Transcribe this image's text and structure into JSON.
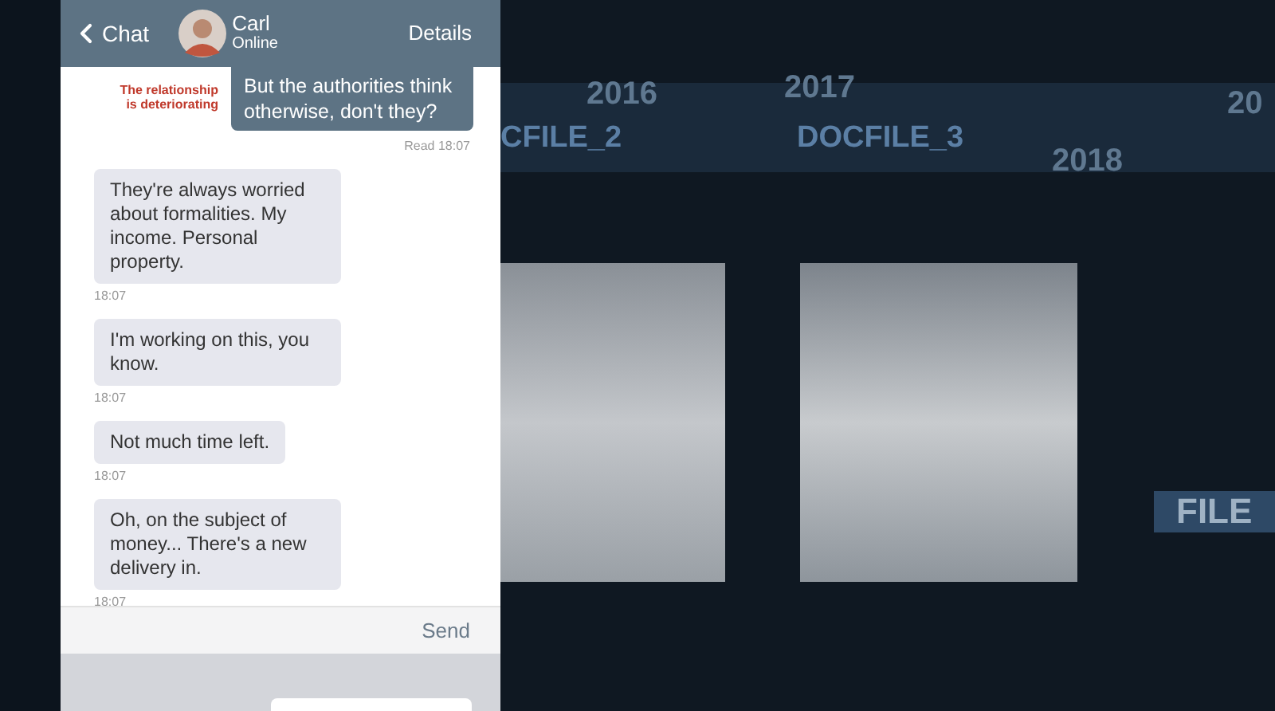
{
  "header": {
    "back": "Chat",
    "contact": {
      "name": "Carl",
      "status": "Online"
    },
    "details": "Details"
  },
  "messages": [
    {
      "kind": "outgoing",
      "text": "But the authorities think otherwise, don't they?",
      "note": "The relationship is deteriorating",
      "meta": "Read 18:07"
    },
    {
      "kind": "incoming",
      "text": "They're always worried about formalities. My income. Personal property.",
      "meta": "18:07"
    },
    {
      "kind": "incoming",
      "text": "I'm working on this, you know.",
      "meta": "18:07"
    },
    {
      "kind": "incoming",
      "text": "Not much time left.",
      "meta": "18:07"
    },
    {
      "kind": "incoming",
      "text": "Oh, on the subject of money... There's a new delivery in.",
      "meta": "18:07"
    }
  ],
  "composer": {
    "send": "Send"
  },
  "background": {
    "years": [
      "2016",
      "2017",
      "2018",
      "20"
    ],
    "files": [
      "CFILE_2",
      "DOCFILE_3"
    ],
    "side_label": "FILE"
  }
}
